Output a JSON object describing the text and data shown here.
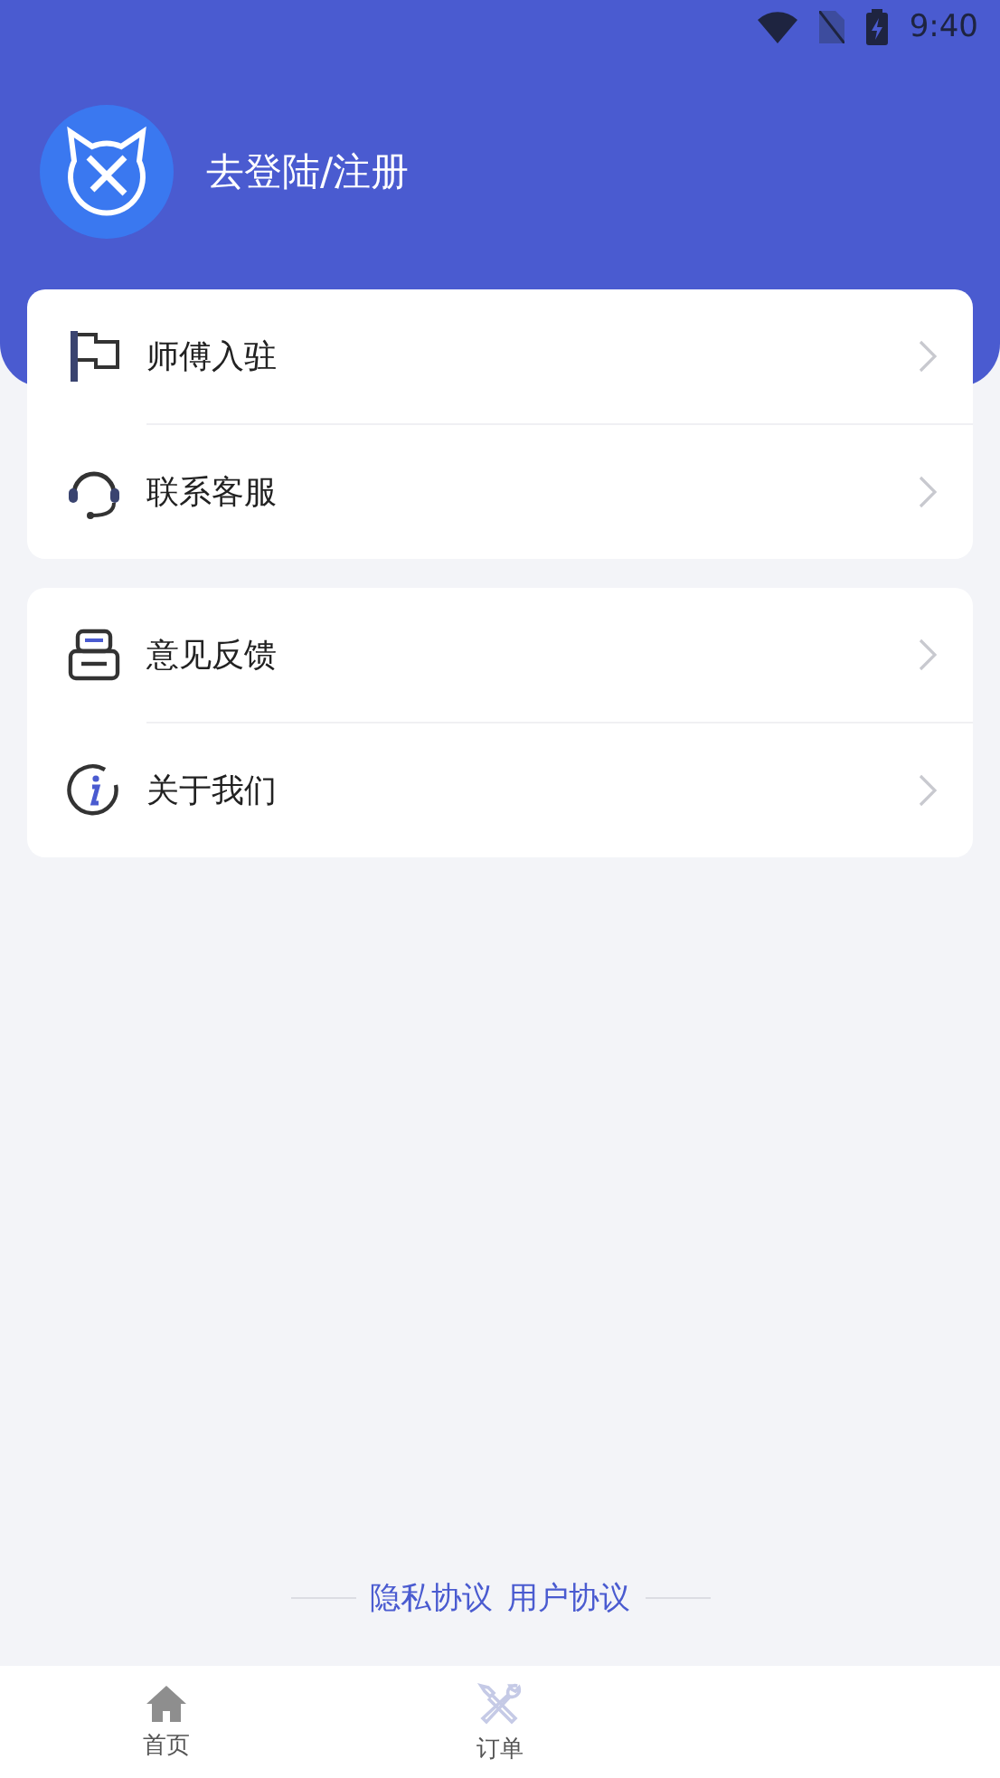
{
  "status_bar": {
    "time": "9:40"
  },
  "header": {
    "login_label": "去登陆/注册"
  },
  "menu_groups": [
    {
      "items": [
        {
          "kind": "flag",
          "label": "师傅入驻"
        },
        {
          "kind": "headset",
          "label": "联系客服"
        }
      ]
    },
    {
      "items": [
        {
          "kind": "feedback",
          "label": "意见反馈"
        },
        {
          "kind": "info",
          "label": "关于我们"
        }
      ]
    }
  ],
  "footer_links": [
    "隐私协议",
    "用户协议"
  ],
  "tab_bar": [
    {
      "kind": "home",
      "label": "首页",
      "selected": false
    },
    {
      "kind": "tools",
      "label": "订单",
      "selected": false
    }
  ]
}
